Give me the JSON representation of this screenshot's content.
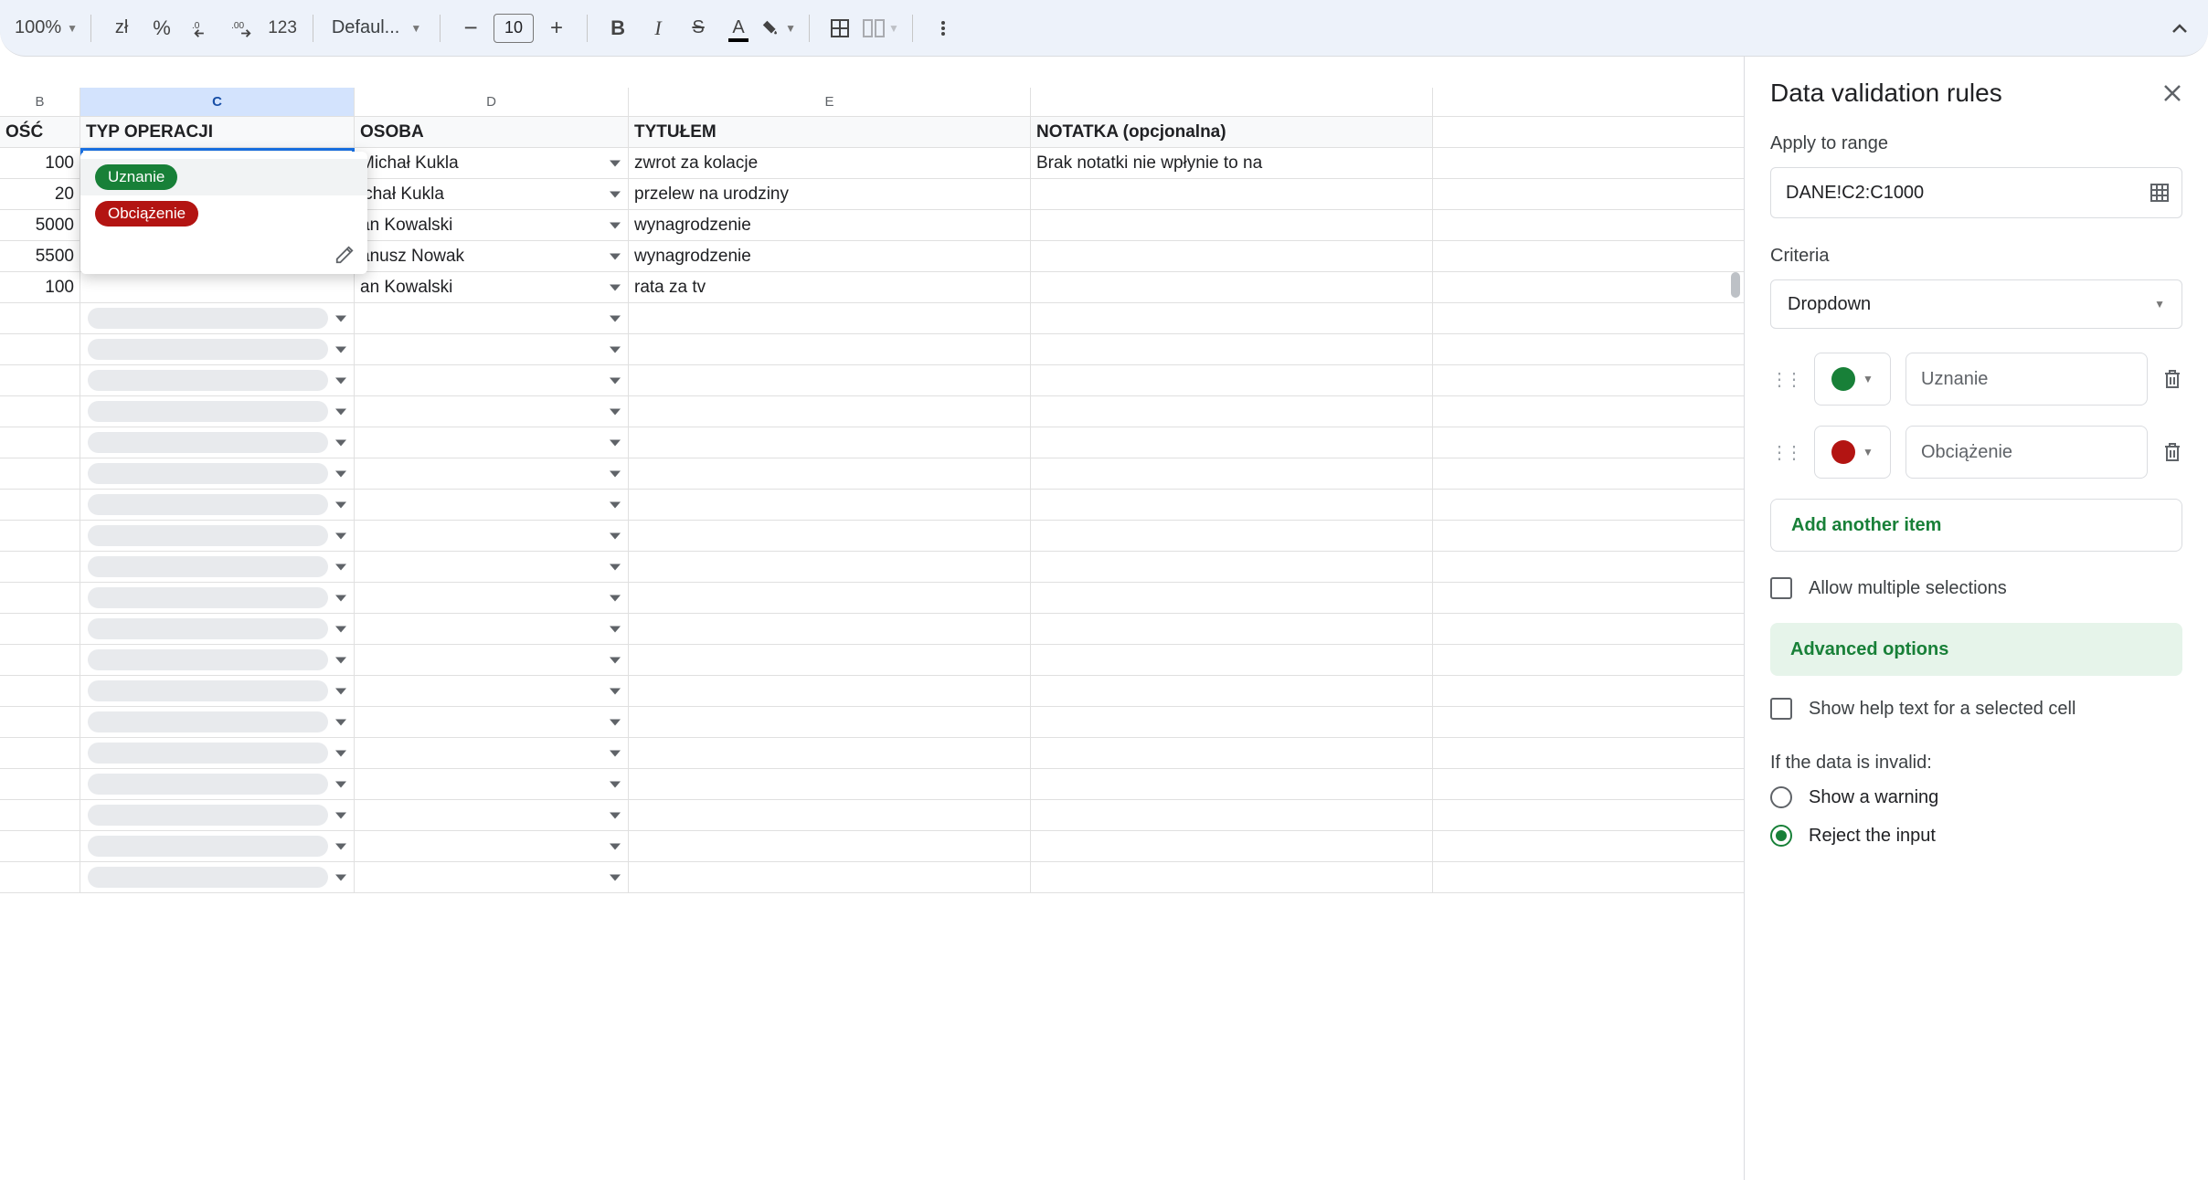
{
  "toolbar": {
    "zoom": "100%",
    "currency": "zł",
    "percent": "%",
    "font": "Defaul...",
    "font_size": "10",
    "dec_dec_tip": ".0_",
    "inc_dec_tip": ".00",
    "num_fmt": "123"
  },
  "columns": {
    "b": "B",
    "c": "C",
    "d": "D",
    "e": "E",
    "f": ""
  },
  "headers": {
    "b": "OŚĆ",
    "c": "TYP OPERACJI",
    "d": "OSOBA",
    "e": "TYTUŁEM",
    "f": "NOTATKA (opcjonalna)"
  },
  "rows": [
    {
      "b": "100",
      "c": "Uznanie",
      "d": "Michał Kukla",
      "e": "zwrot za kolacje",
      "f": "Brak notatki nie wpłynie to na"
    },
    {
      "b": "20",
      "c": "",
      "d": "ichał Kukla",
      "e": "przelew na urodziny",
      "f": ""
    },
    {
      "b": "5000",
      "c": "",
      "d": "an Kowalski",
      "e": "wynagrodzenie",
      "f": ""
    },
    {
      "b": "5500",
      "c": "",
      "d": "anusz Nowak",
      "e": "wynagrodzenie",
      "f": ""
    },
    {
      "b": "100",
      "c": "",
      "d": "an Kowalski",
      "e": "rata za tv",
      "f": ""
    }
  ],
  "dropdown": {
    "option1": "Uznanie",
    "option2": "Obciążenie"
  },
  "panel": {
    "title": "Data validation rules",
    "apply_label": "Apply to range",
    "range": "DANE!C2:C1000",
    "criteria_label": "Criteria",
    "criteria_value": "Dropdown",
    "item1": "Uznanie",
    "item2": "Obciążenie",
    "add_item": "Add another item",
    "allow_multi": "Allow multiple selections",
    "advanced": "Advanced options",
    "show_help": "Show help text for a selected cell",
    "invalid_label": "If the data is invalid:",
    "radio1": "Show a warning",
    "radio2": "Reject the input"
  }
}
